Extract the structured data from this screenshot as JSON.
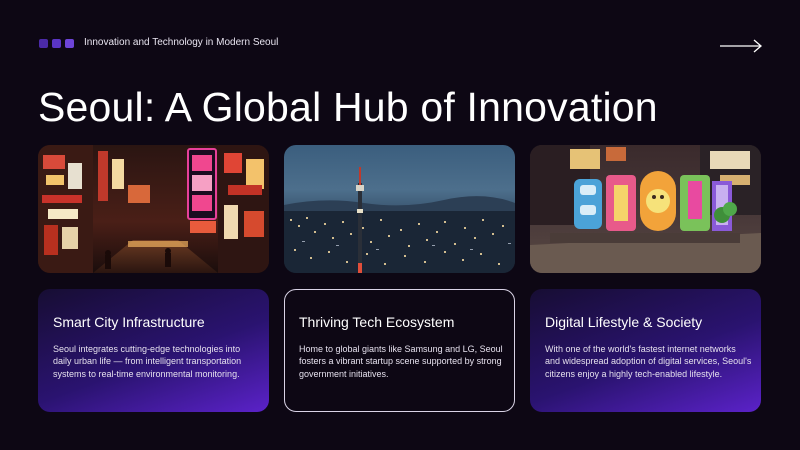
{
  "header": {
    "topic": "Innovation and Technology in Modern Seoul",
    "dot_colors": [
      "#4b2aa8",
      "#5a35c4",
      "#6d44d8"
    ],
    "next_icon": "arrow-right-icon"
  },
  "title": "Seoul: A Global Hub of Innovation",
  "photos": [
    {
      "name": "neon-street-photo",
      "description_icon": "photo"
    },
    {
      "name": "city-skyline-photo",
      "description_icon": "photo"
    },
    {
      "name": "seoul-sign-photo",
      "description_icon": "photo"
    }
  ],
  "cards": [
    {
      "title": "Smart City Infrastructure",
      "body": "Seoul integrates cutting-edge technologies into daily urban life — from intelligent transportation systems to real-time environmental monitoring."
    },
    {
      "title": "Thriving Tech Ecosystem",
      "body": "Home to global giants like Samsung and LG, Seoul fosters a vibrant startup scene supported by strong government initiatives."
    },
    {
      "title": "Digital Lifestyle & Society",
      "body": "With one of the world's fastest internet networks and widespread adoption of digital services, Seoul's citizens enjoy a highly tech-enabled lifestyle."
    }
  ],
  "colors": {
    "background": "#0d0714",
    "accent_purple": "#5b22c9"
  }
}
